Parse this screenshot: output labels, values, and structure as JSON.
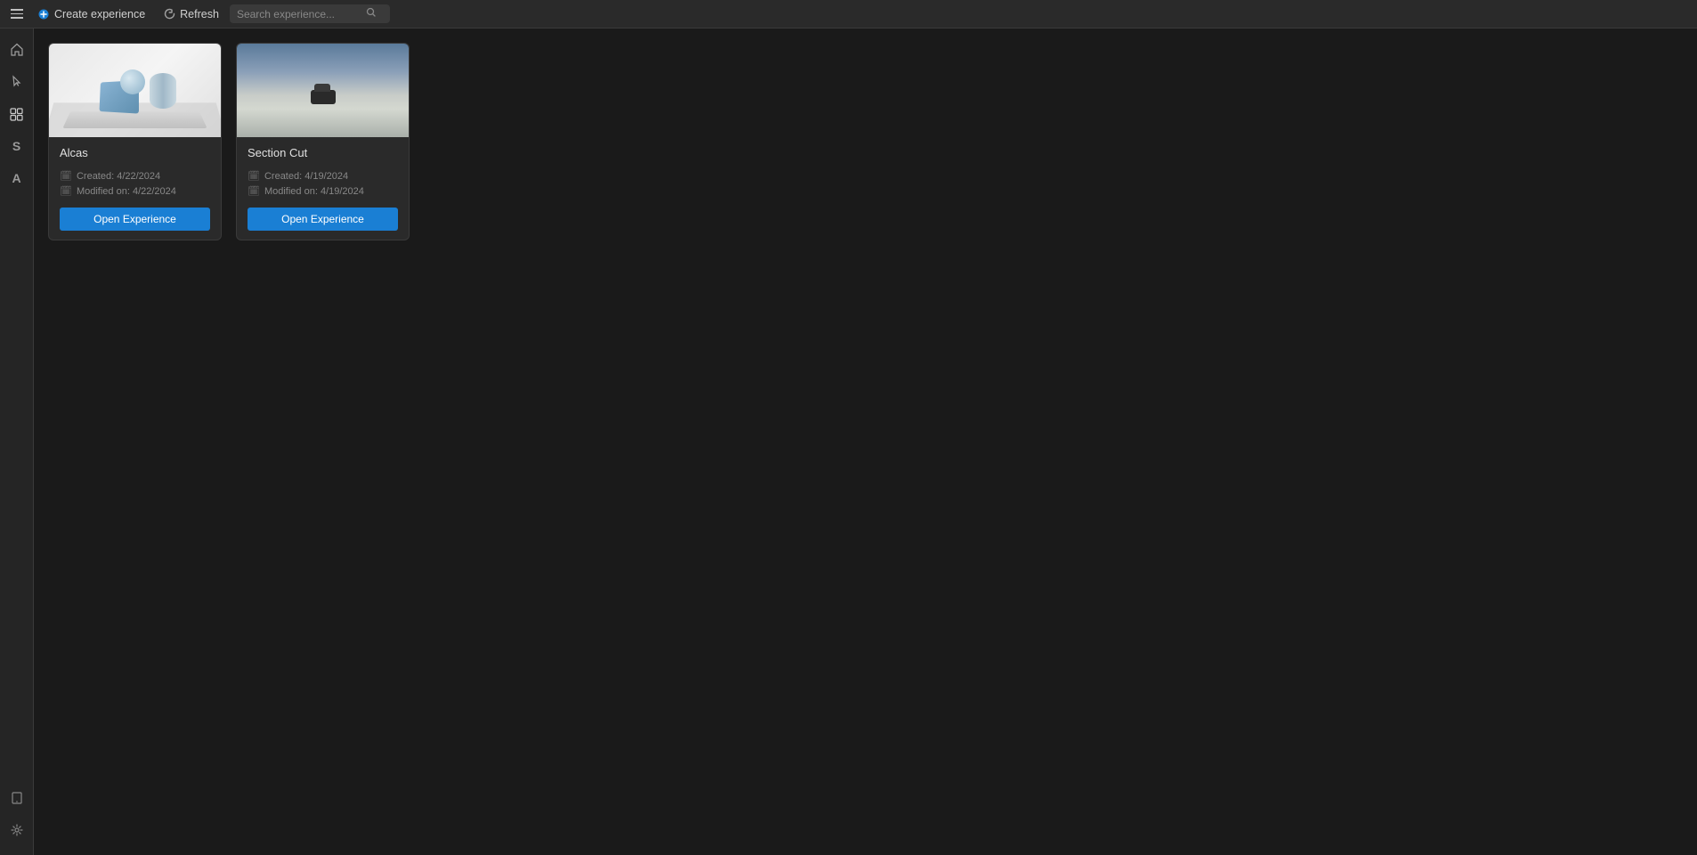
{
  "topbar": {
    "menu_label": "Menu",
    "create_label": "Create experience",
    "refresh_label": "Refresh",
    "search_placeholder": "Search experience..."
  },
  "sidebar": {
    "items": [
      {
        "id": "home",
        "label": "Home",
        "icon": "home"
      },
      {
        "id": "cursor",
        "label": "Cursor",
        "icon": "cursor"
      },
      {
        "id": "data-library",
        "label": "3D Data Library",
        "icon": "grid"
      },
      {
        "id": "s-tool",
        "label": "S Tool",
        "icon": "s"
      },
      {
        "id": "a-tool",
        "label": "A Tool",
        "icon": "a"
      }
    ],
    "bottom_items": [
      {
        "id": "phone",
        "label": "Phone",
        "icon": "phone"
      },
      {
        "id": "settings",
        "label": "Settings",
        "icon": "gear"
      }
    ]
  },
  "experiences": [
    {
      "id": "alcas",
      "title": "Alcas",
      "created": "Created: 4/22/2024",
      "modified": "Modified on: 4/22/2024",
      "open_label": "Open Experience",
      "thumbnail_type": "alcas"
    },
    {
      "id": "section-cut",
      "title": "Section Cut",
      "created": "Created: 4/19/2024",
      "modified": "Modified on: 4/19/2024",
      "open_label": "Open Experience",
      "thumbnail_type": "section-cut"
    }
  ]
}
